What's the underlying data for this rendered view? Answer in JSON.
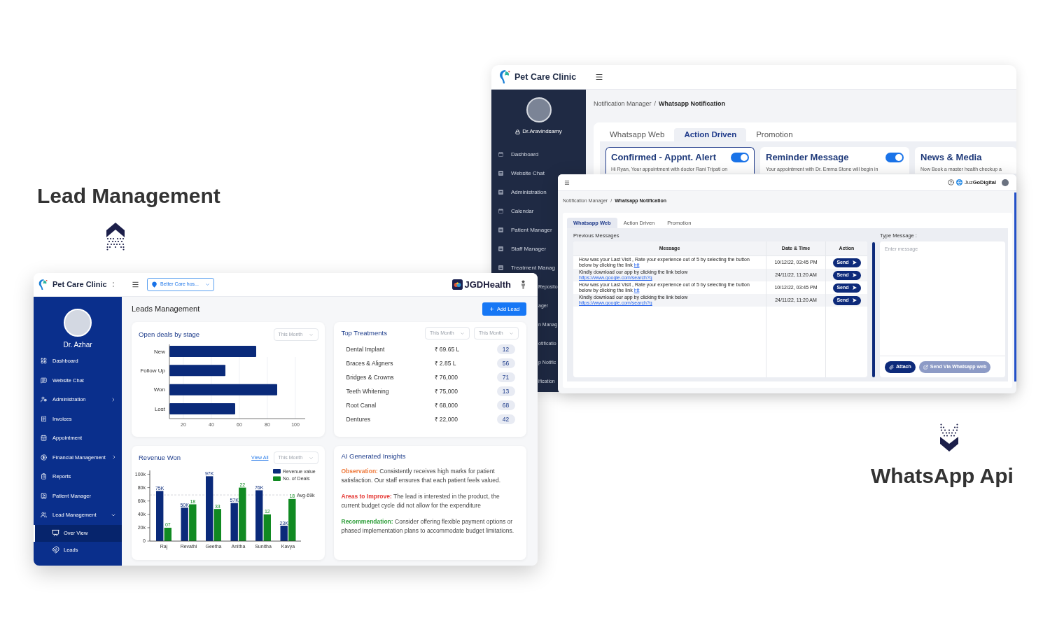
{
  "notification_window_back": {
    "brand": "Pet Care Clinic",
    "user": "Dr.Aravindsamy",
    "sidebar_items": [
      {
        "label": "Dashboard",
        "kind": "full",
        "selected": false
      },
      {
        "label": "Website Chat",
        "kind": "full",
        "selected": false
      },
      {
        "label": "Administration",
        "kind": "full",
        "selected": false
      },
      {
        "label": "Calendar",
        "kind": "full",
        "selected": false
      },
      {
        "label": "Patient Manager",
        "kind": "full",
        "selected": false
      },
      {
        "label": "Staff Manager",
        "kind": "full",
        "selected": false
      },
      {
        "label": "Treatment Manag",
        "kind": "full",
        "selected": false
      },
      {
        "label": "Reposito",
        "kind": "clipped",
        "selected": false
      },
      {
        "label": "ager",
        "kind": "clipped",
        "selected": false
      },
      {
        "label": "n Manag",
        "kind": "clipped",
        "selected": false
      },
      {
        "label": "otificatio",
        "kind": "clipped",
        "selected": false
      },
      {
        "label": "p Notific",
        "kind": "clipped",
        "selected": false
      },
      {
        "label": "ification",
        "kind": "clipped",
        "selected": false
      }
    ],
    "breadcrumb": {
      "items": [
        "Notification Manager",
        "Whatsapp Notification"
      ],
      "separator": "/"
    },
    "tabs": [
      {
        "label": "Whatsapp Web",
        "selected": false
      },
      {
        "label": "Action Driven",
        "selected": true
      },
      {
        "label": "Promotion",
        "selected": false
      }
    ],
    "cards": [
      {
        "title": "Confirmed - Appnt. Alert",
        "on": true,
        "text": "Hi Ryan, Your appointment with doctor Rani Tripati on",
        "selected": true
      },
      {
        "title": "Reminder Message",
        "on": true,
        "text": "Your appointment with Dr. Emma Stone will begin in",
        "selected": false
      },
      {
        "title": "News & Media",
        "text": "Now Book a master health checkup a",
        "selected": false
      }
    ]
  },
  "lead_caption": {
    "title": "Lead Management"
  },
  "notification_window_front": {
    "company": "Juz**GoDigital**",
    "breadcrumb": {
      "items": [
        "Notification Manager",
        "Whatsapp Notification"
      ],
      "separator": "/"
    },
    "tabs": [
      {
        "label": "Whatsapp Web",
        "selected": true
      },
      {
        "label": "Action Driven",
        "selected": false
      },
      {
        "label": "Promotion",
        "selected": false
      }
    ],
    "messages_title": "Previous Messages",
    "table": {
      "columns": [
        "Message",
        "Date & Time",
        "Action"
      ],
      "rows": [
        {
          "message": "How was your Last Visit , Rate your experience out of 5 by selecting the button below by clicking the link",
          "link": "htt",
          "date": "10/12/22, 03:45 PM",
          "action": "Send"
        },
        {
          "message": "Kindly download our app by clicking the link below",
          "link": "https://www.google.com/search?q",
          "date": "24/11/22, 11:20 AM",
          "action": "Send"
        },
        {
          "message": "How was your Last Visit , Rate your experience out of 5 by selecting the button below by clicking the link",
          "link": "htt",
          "date": "10/12/22, 03:45 PM",
          "action": "Send"
        },
        {
          "message": "Kindly download our app by clicking the link below",
          "link": "https://www.google.com/search?q",
          "date": "24/11/22, 11:20 AM",
          "action": "Send"
        }
      ]
    },
    "compose": {
      "label": "Type Message :",
      "placeholder": "Enter message",
      "buttons": [
        {
          "kind": "attach",
          "label": "Attach",
          "disabled": false
        },
        {
          "kind": "send",
          "label": "Send Via Whatsapp web",
          "disabled": true
        }
      ]
    }
  },
  "lead_window": {
    "brand": "Pet Care Clinic",
    "location": "Better Care hos...",
    "company": "JGDHealth",
    "user": "Dr. Azhar",
    "sidebar_items": [
      {
        "label": "Dashboard",
        "selected": false
      },
      {
        "label": "Website Chat",
        "selected": false
      },
      {
        "label": "Administration",
        "selected": false,
        "expanded": false
      },
      {
        "label": "Invoices",
        "selected": false
      },
      {
        "label": "Appointment",
        "selected": false
      },
      {
        "label": "Financial Management",
        "selected": false,
        "expanded": false
      },
      {
        "label": "Reports",
        "selected": false
      },
      {
        "label": "Patient Manager",
        "selected": false
      },
      {
        "label": "Lead Management",
        "selected": false,
        "expanded": true,
        "children": [
          {
            "label": "Over View",
            "selected": true
          },
          {
            "label": "Leads",
            "selected": false
          }
        ]
      }
    ],
    "page_title": "Leads Management",
    "add_button": "Add Lead",
    "deals_card": {
      "title": "Open deals by stage",
      "period": "This Month",
      "chart_data": {
        "type": "bar",
        "orientation": "horizontal",
        "categories": [
          "New",
          "Follow Up",
          "Won",
          "Lost"
        ],
        "values": [
          72,
          50,
          87,
          57
        ],
        "xlim": [
          10,
          106
        ],
        "xticks": [
          20,
          40,
          60,
          80,
          100
        ],
        "grid": true
      }
    },
    "treatments_card": {
      "title": "Top Treatments",
      "filters": [
        "This Month",
        "This Month"
      ],
      "rows": [
        {
          "name": "Dental Implant",
          "amount": "₹ 69.65 L",
          "count": "12"
        },
        {
          "name": "Braces & Aligners",
          "amount": "₹ 2.85 L",
          "count": "56"
        },
        {
          "name": "Bridges & Crowns",
          "amount": "₹ 76,000",
          "count": "71"
        },
        {
          "name": "Teeth Whitening",
          "amount": "₹ 75,000",
          "count": "13"
        },
        {
          "name": "Root Canal",
          "amount": "₹ 68,000",
          "count": "68"
        },
        {
          "name": "Dentures",
          "amount": "₹ 22,000",
          "count": "42"
        }
      ]
    },
    "revenue_card": {
      "title": "Revenue Won",
      "link": "View All",
      "period": "This Month",
      "chart_data": {
        "type": "bar",
        "categories": [
          "Raj",
          "Revathi",
          "Geetha",
          "Anitha",
          "Sunitha",
          "Kavya"
        ],
        "series": [
          {
            "name": "Revenue value",
            "color": "#0a2a7a",
            "values": [
              75000,
              50000,
              97000,
              57000,
              76000,
              23000
            ],
            "value_labels": [
              "75K",
              "50K",
              "97K",
              "57K",
              "76K",
              "23K"
            ]
          },
          {
            "name": "No. of Deals",
            "color": "#118a22",
            "values": [
              20000,
              55000,
              48000,
              80000,
              40000,
              63000
            ],
            "value_labels": [
              null,
              null,
              null,
              null,
              null,
              null
            ]
          }
        ],
        "ylim": [
          0,
          105000
        ],
        "yticks": [
          {
            "value": 0,
            "label": "0"
          },
          {
            "value": 20000,
            "label": "20k"
          },
          {
            "value": 40000,
            "label": "40k"
          },
          {
            "value": 60000,
            "label": "60k"
          },
          {
            "value": 80000,
            "label": "80k"
          },
          {
            "value": 100000,
            "label": "100k"
          }
        ],
        "data_labels": true,
        "legend": "upper right",
        "ref_lines": [
          {
            "axis": "y",
            "value": 69000,
            "label": "Avg-69k"
          }
        ],
        "annotations": [
          {
            "text": "07",
            "x": "Raj",
            "y": 20000
          },
          {
            "text": "18",
            "x": "Revathi",
            "y": 55000
          },
          {
            "text": "33",
            "x": "Geetha",
            "y": 48000
          },
          {
            "text": "22",
            "x": "Anitha",
            "y": 80000
          },
          {
            "text": "12",
            "x": "Sunitha",
            "y": 40000
          },
          {
            "text": "18",
            "x": "Kavya",
            "y": 63000
          }
        ]
      }
    },
    "insights_card": {
      "title": "AI Generated Insights",
      "items": [
        {
          "label": "Observation:",
          "text": "Consistently receives high marks for patient satisfaction. Our staff ensures that each patient feels valued.",
          "color": "#ee7a3c"
        },
        {
          "label": "Areas to Improve:",
          "text": "The lead is interested in the product, the current budget cycle did not allow for the expenditure",
          "color": "#e53935"
        },
        {
          "label": "Recommendation:",
          "text": "Consider offering flexible payment options or phased implementation plans to accommodate budget limitations.",
          "color": "#2e9e3a"
        }
      ]
    }
  },
  "whatsapp_caption": {
    "title": "WhatsApp Api"
  }
}
